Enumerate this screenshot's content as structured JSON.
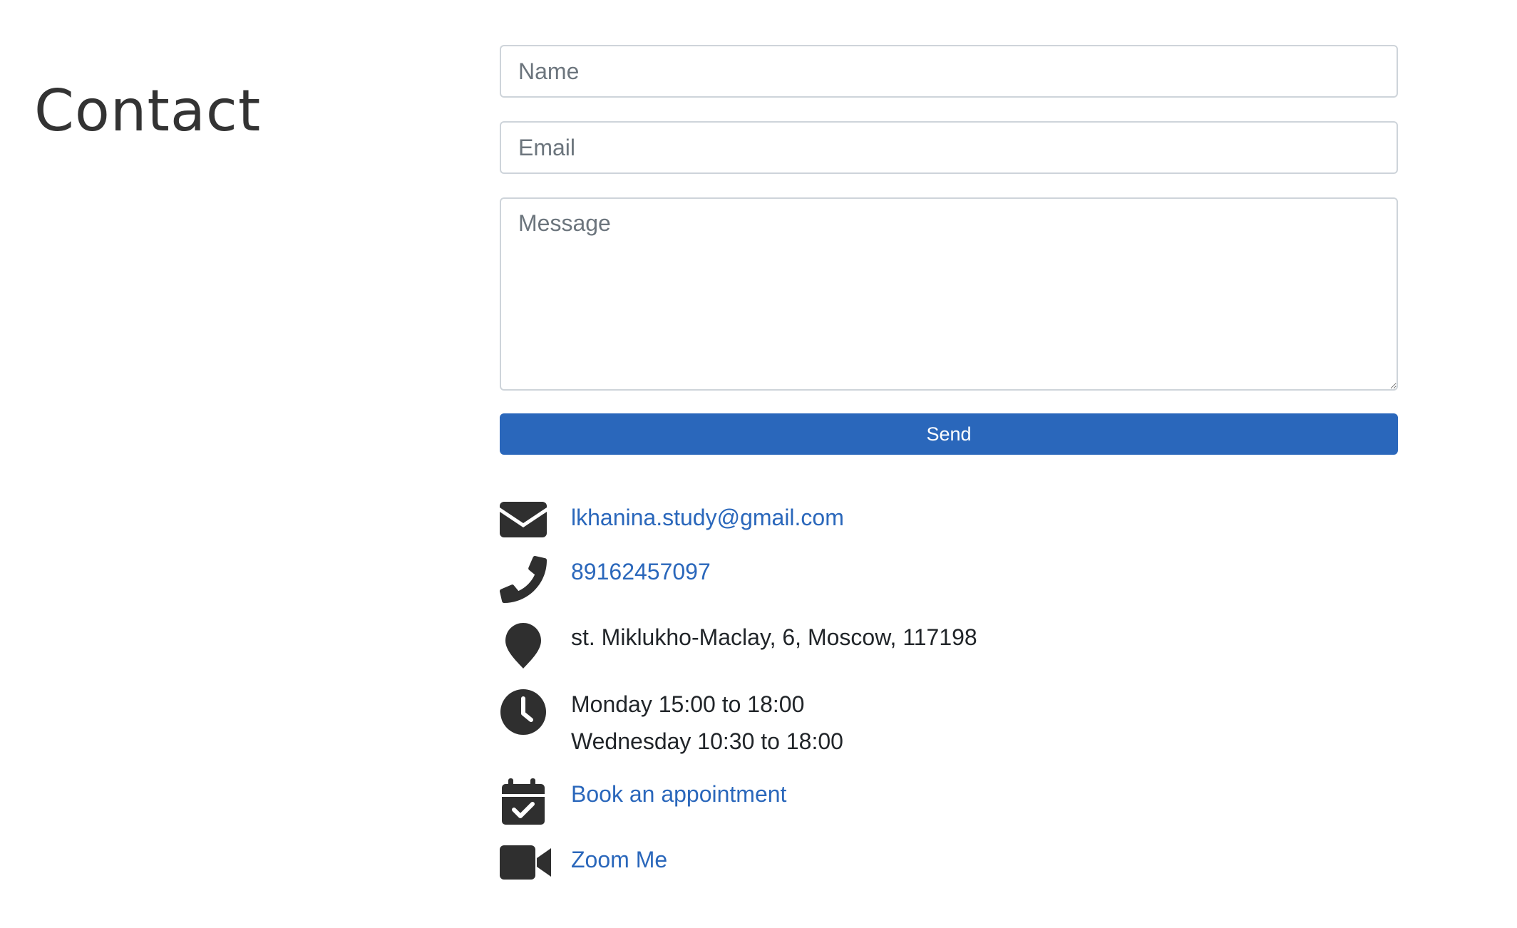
{
  "page": {
    "title": "Contact"
  },
  "form": {
    "name_placeholder": "Name",
    "email_placeholder": "Email",
    "message_placeholder": "Message",
    "send_label": "Send"
  },
  "contact": {
    "email": "lkhanina.study@gmail.com",
    "phone": "89162457097",
    "address": "st. Miklukho-Maclay, 6, Moscow, 117198",
    "hours": [
      "Monday 15:00 to 18:00",
      "Wednesday 10:30 to 18:00"
    ],
    "appointment_label": "Book an appointment",
    "zoom_label": "Zoom Me"
  },
  "icons": {
    "email": "envelope-icon",
    "phone": "phone-icon",
    "address": "map-pin-icon",
    "hours": "clock-icon",
    "appointment": "calendar-check-icon",
    "zoom": "video-camera-icon"
  },
  "colors": {
    "accent": "#2a67bb",
    "icon": "#2f2f2f",
    "text": "#212529",
    "border": "#ced4da"
  }
}
